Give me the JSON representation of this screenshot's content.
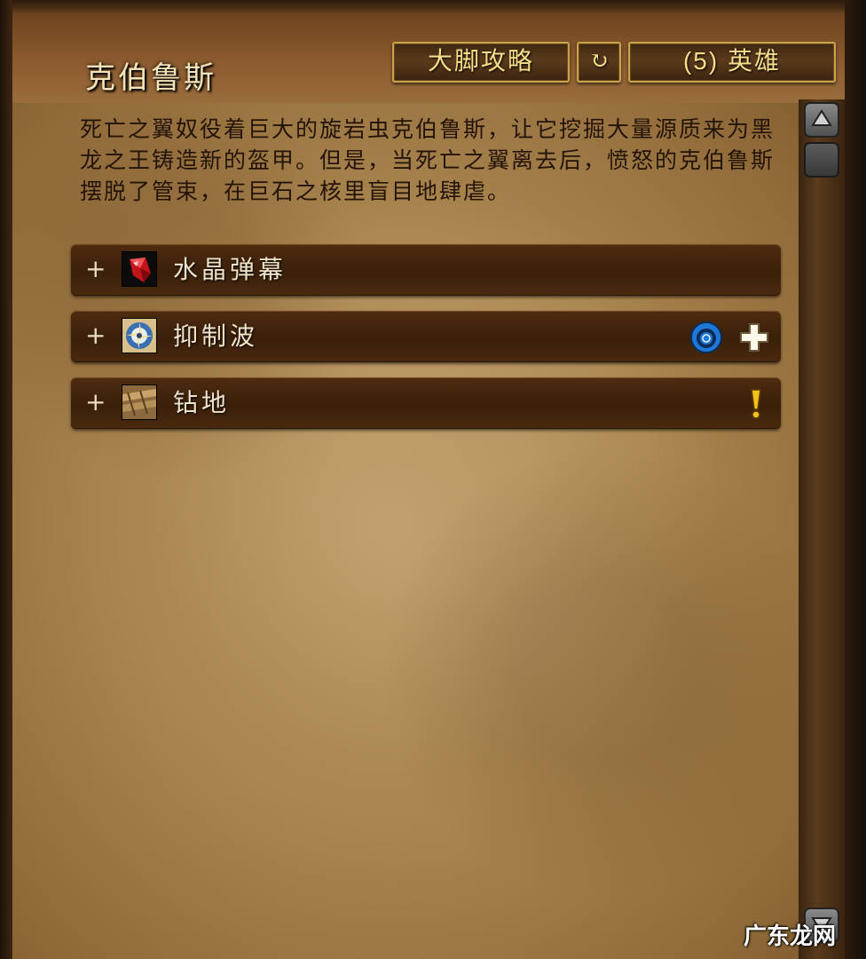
{
  "encounter": {
    "title": "克伯鲁斯",
    "description": "死亡之翼奴役着巨大的旋岩虫克伯鲁斯，让它挖掘大量源质来为黑龙之王铸造新的盔甲。但是，当死亡之翼离去后，愤怒的克伯鲁斯摆脱了管束，在巨石之核里盲目地肆虐。"
  },
  "header": {
    "guide_button": "大脚攻略",
    "reset_icon": "↻",
    "difficulty_button": "(5) 英雄"
  },
  "abilities": [
    {
      "expand": "+",
      "label": "水晶弹幕",
      "icon": "red-crystal-icon",
      "flags": []
    },
    {
      "expand": "+",
      "label": "抑制波",
      "icon": "dampening-wave-icon",
      "flags": [
        "interrupt-icon",
        "healer-icon"
      ]
    },
    {
      "expand": "+",
      "label": "钻地",
      "icon": "burrow-icon",
      "flags": [
        "important-icon"
      ]
    }
  ],
  "colors": {
    "parchment": "#a9854f",
    "ability_bar": "#3a1f0a",
    "button_border": "#c9a24d",
    "button_text": "#f5dd8a",
    "interrupt_blue": "#1e78d8",
    "important_yellow": "#f2c21a"
  },
  "watermark": "广东龙网"
}
